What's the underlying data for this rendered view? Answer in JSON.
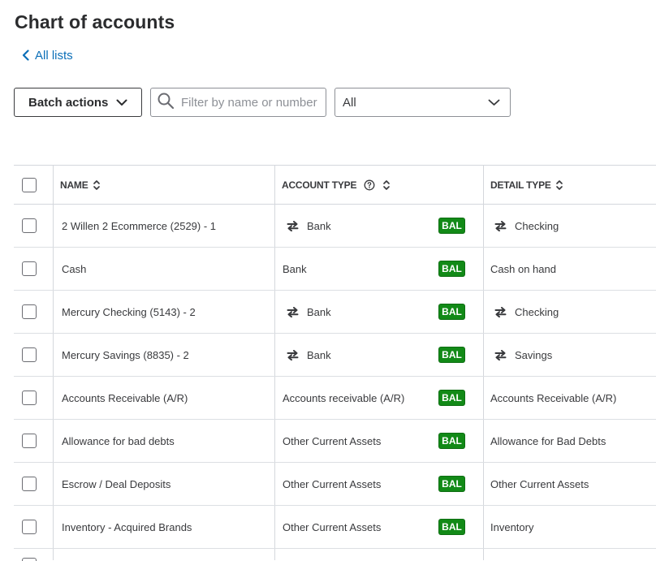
{
  "page": {
    "title": "Chart of accounts",
    "back_link_label": "All lists"
  },
  "toolbar": {
    "batch_actions_label": "Batch actions",
    "filter_placeholder": "Filter by name or number",
    "filter_value": "",
    "type_filter_value": "All"
  },
  "table": {
    "columns": {
      "name": "NAME",
      "account_type": "ACCOUNT TYPE",
      "detail_type": "DETAIL TYPE"
    },
    "rows": [
      {
        "name": "2 Willen 2 Ecommerce (2529) - 1",
        "account_type": "Bank",
        "badge": "BAL",
        "detail_type": "Checking",
        "synced": true
      },
      {
        "name": "Cash",
        "account_type": "Bank",
        "badge": "BAL",
        "detail_type": "Cash on hand",
        "synced": false
      },
      {
        "name": "Mercury Checking (5143) - 2",
        "account_type": "Bank",
        "badge": "BAL",
        "detail_type": "Checking",
        "synced": true
      },
      {
        "name": "Mercury Savings (8835) - 2",
        "account_type": "Bank",
        "badge": "BAL",
        "detail_type": "Savings",
        "synced": true
      },
      {
        "name": "Accounts Receivable (A/R)",
        "account_type": "Accounts receivable (A/R)",
        "badge": "BAL",
        "detail_type": "Accounts Receivable (A/R)",
        "synced": false
      },
      {
        "name": "Allowance for bad debts",
        "account_type": "Other Current Assets",
        "badge": "BAL",
        "detail_type": "Allowance for Bad Debts",
        "synced": false
      },
      {
        "name": "Escrow / Deal Deposits",
        "account_type": "Other Current Assets",
        "badge": "BAL",
        "detail_type": "Other Current Assets",
        "synced": false
      },
      {
        "name": "Inventory - Acquired Brands",
        "account_type": "Other Current Assets",
        "badge": "BAL",
        "detail_type": "Inventory",
        "synced": false
      }
    ]
  },
  "icons": {
    "back": "chevron-left-icon",
    "batch_dropdown": "chevron-down-icon",
    "search": "search-icon",
    "select_dropdown": "chevron-down-icon",
    "sort": "sort-icon",
    "help": "help-circle-icon",
    "connected_account": "sync-arrows-icon"
  },
  "colors": {
    "link": "#0b6fb8",
    "badge_bg": "#128a17",
    "badge_text": "#ffffff",
    "title": "#2b2c2e",
    "border": "#d4d7dc"
  }
}
